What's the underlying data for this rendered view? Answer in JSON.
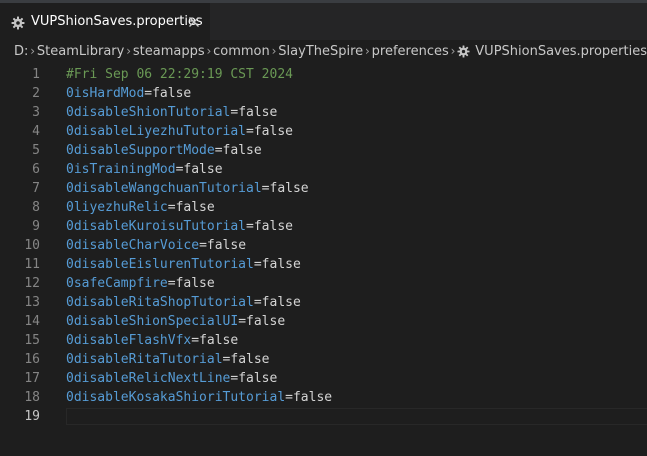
{
  "tab": {
    "icon": "gear-icon",
    "title": "VUPShionSaves.properties",
    "close_icon": "close-icon"
  },
  "breadcrumb": {
    "items": [
      "D:",
      "SteamLibrary",
      "steamapps",
      "common",
      "SlayTheSpire",
      "preferences"
    ],
    "file": "VUPShionSaves.properties",
    "file_icon": "gear-icon"
  },
  "editor": {
    "current_line": 19,
    "lines": [
      {
        "num": "1",
        "comment": "#Fri Sep 06 22:29:19 CST 2024"
      },
      {
        "num": "2",
        "key": "0isHardMod",
        "eq": "=",
        "value": "false"
      },
      {
        "num": "3",
        "key": "0disableShionTutorial",
        "eq": "=",
        "value": "false"
      },
      {
        "num": "4",
        "key": "0disableLiyezhuTutorial",
        "eq": "=",
        "value": "false"
      },
      {
        "num": "5",
        "key": "0disableSupportMode",
        "eq": "=",
        "value": "false"
      },
      {
        "num": "6",
        "key": "0isTrainingMod",
        "eq": "=",
        "value": "false"
      },
      {
        "num": "7",
        "key": "0disableWangchuanTutorial",
        "eq": "=",
        "value": "false"
      },
      {
        "num": "8",
        "key": "0liyezhuRelic",
        "eq": "=",
        "value": "false"
      },
      {
        "num": "9",
        "key": "0disableKuroisuTutorial",
        "eq": "=",
        "value": "false"
      },
      {
        "num": "10",
        "key": "0disableCharVoice",
        "eq": "=",
        "value": "false"
      },
      {
        "num": "11",
        "key": "0disableEislurenTutorial",
        "eq": "=",
        "value": "false"
      },
      {
        "num": "12",
        "key": "0safeCampfire",
        "eq": "=",
        "value": "false"
      },
      {
        "num": "13",
        "key": "0disableRitaShopTutorial",
        "eq": "=",
        "value": "false"
      },
      {
        "num": "14",
        "key": "0disableShionSpecialUI",
        "eq": "=",
        "value": "false"
      },
      {
        "num": "15",
        "key": "0disableFlashVfx",
        "eq": "=",
        "value": "false"
      },
      {
        "num": "16",
        "key": "0disableRitaTutorial",
        "eq": "=",
        "value": "false"
      },
      {
        "num": "17",
        "key": "0disableRelicNextLine",
        "eq": "=",
        "value": "false"
      },
      {
        "num": "18",
        "key": "0disableKosakaShioriTutorial",
        "eq": "=",
        "value": "false"
      },
      {
        "num": "19"
      }
    ]
  },
  "colors": {
    "key": "#569cd6",
    "comment": "#6a9955",
    "text": "#d4d4d4",
    "line_number": "#858585",
    "background": "#1e1e1e"
  }
}
